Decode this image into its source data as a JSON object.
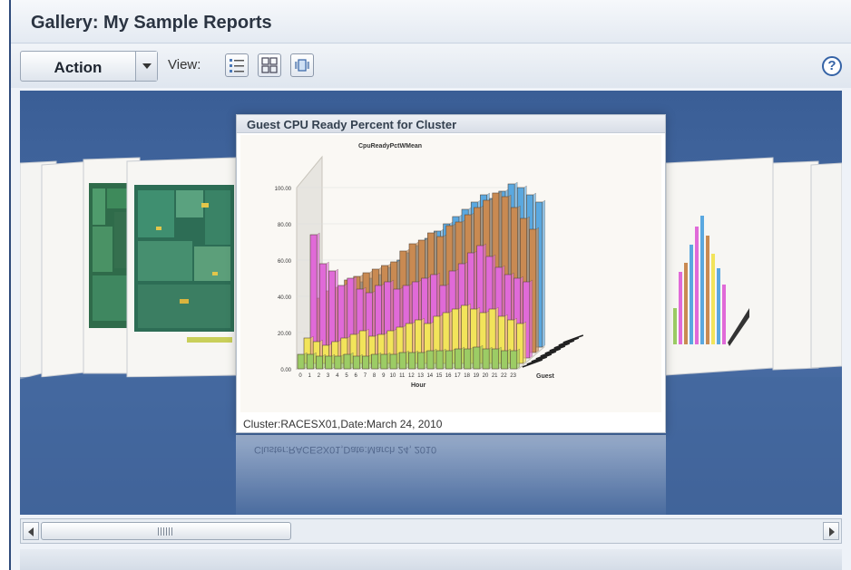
{
  "window": {
    "title": "Gallery: My Sample Reports"
  },
  "toolbar": {
    "action_label": "Action",
    "view_label": "View:",
    "view_modes": [
      "list-view-icon",
      "grid-view-icon",
      "coverflow-view-icon"
    ],
    "help_label": "?"
  },
  "featured_report": {
    "title": "Guest CPU Ready Percent for Cluster",
    "caption": "Cluster:RACESX01,Date:March 24, 2010",
    "chart_data": {
      "type": "bar",
      "title": "CpuReadyPctWMean",
      "xlabel": "Hour",
      "ylabel": "",
      "zlabel": "Guest",
      "ylim": [
        0,
        100
      ],
      "yticks": [
        "0.00",
        "20.00",
        "40.00",
        "60.00",
        "80.00",
        "100.00"
      ],
      "categories": [
        "0",
        "1",
        "2",
        "3",
        "4",
        "5",
        "6",
        "7",
        "8",
        "9",
        "10",
        "11",
        "12",
        "13",
        "14",
        "15",
        "16",
        "17",
        "18",
        "19",
        "20",
        "21",
        "22",
        "23"
      ],
      "series": [
        {
          "color": "#9ccc65",
          "values": [
            8,
            8,
            7,
            7,
            7,
            8,
            7,
            7,
            8,
            8,
            8,
            9,
            9,
            9,
            10,
            10,
            10,
            11,
            11,
            12,
            11,
            11,
            10,
            10
          ]
        },
        {
          "color": "#f2e45a",
          "values": [
            14,
            12,
            10,
            12,
            14,
            16,
            18,
            15,
            16,
            18,
            20,
            22,
            24,
            22,
            26,
            28,
            30,
            32,
            30,
            28,
            30,
            26,
            24,
            22
          ]
        },
        {
          "color": "#e06ad8",
          "values": [
            68,
            52,
            48,
            40,
            44,
            38,
            36,
            40,
            42,
            38,
            40,
            42,
            44,
            46,
            40,
            48,
            52,
            58,
            62,
            56,
            50,
            46,
            44,
            42
          ]
        },
        {
          "color": "#c98a52",
          "values": [
            30,
            34,
            36,
            40,
            42,
            44,
            46,
            48,
            50,
            56,
            60,
            62,
            66,
            64,
            70,
            72,
            76,
            80,
            84,
            88,
            86,
            80,
            74,
            68
          ]
        },
        {
          "color": "#5aa8e0",
          "values": [
            24,
            28,
            32,
            34,
            36,
            38,
            40,
            44,
            48,
            52,
            56,
            60,
            64,
            68,
            72,
            76,
            80,
            84,
            82,
            86,
            90,
            88,
            84,
            80
          ]
        }
      ]
    }
  },
  "colors": {
    "stage": "#3a5e96",
    "accent": "#3563a6"
  }
}
